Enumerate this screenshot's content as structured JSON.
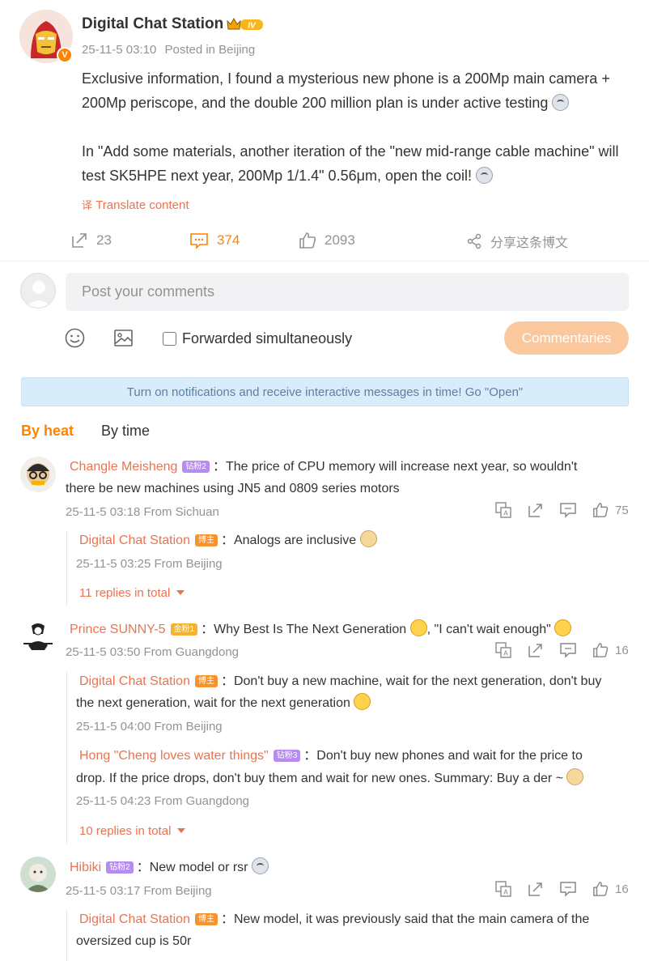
{
  "post": {
    "author": "Digital Chat Station",
    "level_badge": "IV",
    "verified": "V",
    "time": "25-11-5 03:10",
    "location": "Posted in Beijing",
    "para1": " Exclusive information, I found a mysterious new phone is a 200Mp main camera + 200Mp periscope, and the double 200 million plan is under active testing",
    "para2": " In \"Add some materials, another iteration of the \"new mid-range cable machine\" will test SK5HPE next year, 200Mp 1/1.4\" 0.56μm, open the coil!",
    "translate": "Translate content",
    "reposts": "23",
    "comments": "374",
    "likes": "2093",
    "share": "分享这条博文"
  },
  "composer": {
    "placeholder": "Post your comments",
    "forward_label": "Forwarded simultaneously",
    "submit": "Commentaries"
  },
  "notice": "Turn on notifications and receive interactive messages in time! Go \"Open\"",
  "tabs": {
    "heat": "By heat",
    "time": "By time"
  },
  "comments": [
    {
      "user": "Changle Meisheng",
      "badge": "钻粉2",
      "text1": "：The price of CPU memory will increase next year, so wouldn't",
      "text2": "there be new machines using JN5 and 0809 series motors",
      "meta": "25-11-5 03:18 From Sichuan",
      "likes": "75",
      "replies": [
        {
          "user": "Digital Chat Station",
          "badge": "博主",
          "text": "：Analogs are inclusive",
          "meta": "25-11-5 03:25 From Beijing"
        }
      ],
      "more": "11 replies in total"
    },
    {
      "user": "Prince SUNNY-5",
      "badge": "金粉1",
      "text1": "：Why Best Is The Next Generation",
      "text1b": ", \"I can't wait enough\"",
      "meta": "25-11-5 03:50 From Guangdong",
      "likes": "16",
      "replies": [
        {
          "user": "Digital Chat Station",
          "badge": "博主",
          "text": "：Don't buy a new machine, wait for the next generation, don't buy",
          "text2": "the next generation, wait for the next generation",
          "meta": "25-11-5 04:00 From Beijing"
        },
        {
          "user": "Hong \"Cheng loves water things\"",
          "badge": "钻粉3",
          "text": "：Don't buy new phones and wait for the price to",
          "text2": "drop. If the price drops, don't buy them and wait for new ones. Summary: Buy a der ~",
          "meta": "25-11-5 04:23 From Guangdong"
        }
      ],
      "more": "10 replies in total"
    },
    {
      "user": "Hibiki",
      "badge": "钻粉2",
      "text1": "：New model or rsr",
      "meta": "25-11-5 03:17 From Beijing",
      "likes": "16",
      "replies": [
        {
          "user": "Digital Chat Station",
          "badge": "博主",
          "text": "：New model, it was previously said that the main camera of the",
          "text2": "oversized cup is 50r"
        }
      ]
    }
  ]
}
